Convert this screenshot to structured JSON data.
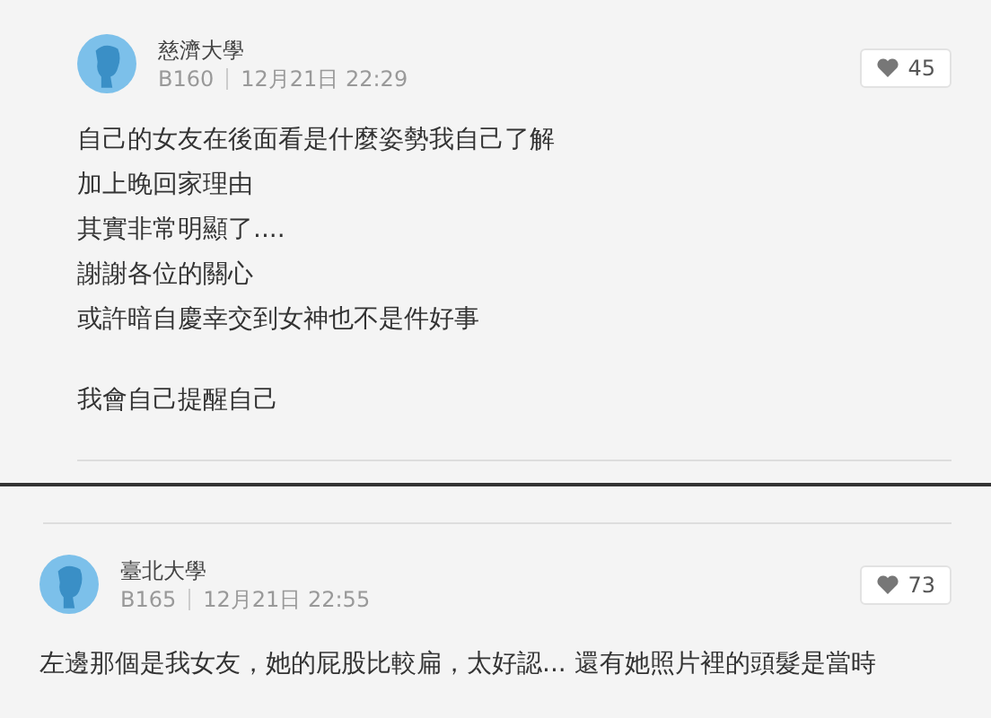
{
  "comments": [
    {
      "school": "慈濟大學",
      "floor": "B160",
      "time": "12月21日 22:29",
      "likes": "45",
      "paragraphs": [
        [
          "自己的女友在後面看是什麼姿勢我自己了解",
          "加上晚回家理由",
          "其實非常明顯了....",
          "謝謝各位的關心",
          "或許暗自慶幸交到女神也不是件好事"
        ],
        [
          "我會自己提醒自己"
        ]
      ]
    },
    {
      "school": "臺北大學",
      "floor": "B165",
      "time": "12月21日 22:55",
      "likes": "73",
      "paragraphs": [
        [
          "左邊那個是我女友，她的屁股比較扁，太好認... 還有她照片裡的頭髮是當時"
        ]
      ]
    }
  ]
}
